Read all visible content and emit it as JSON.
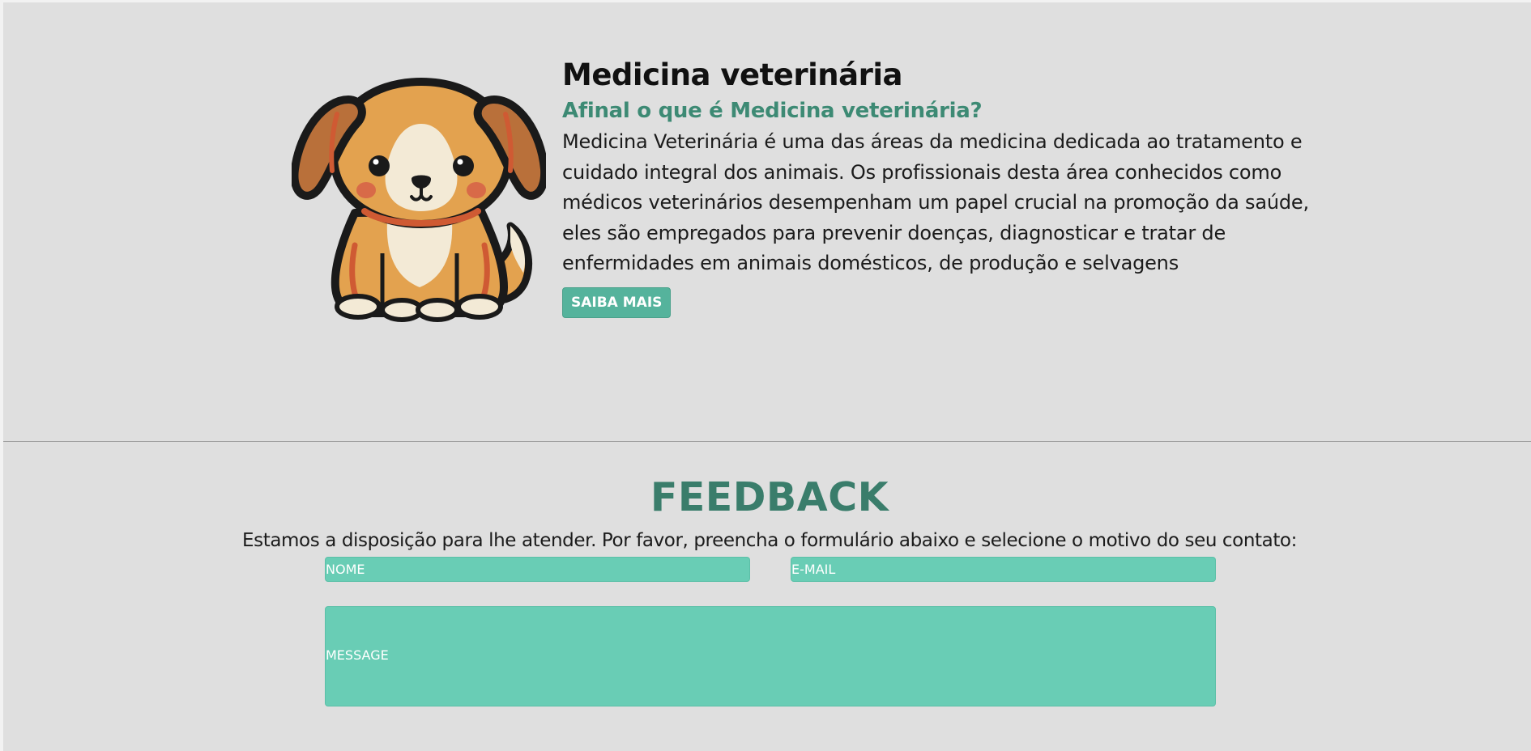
{
  "about": {
    "title": "Medicina veterinária",
    "subtitle": "Afinal o que é Medicina veterinária?",
    "body": "Medicina Veterinária é uma das áreas da medicina dedicada ao tratamento e cuidado integral dos animais. Os profissionais desta área conhecidos como médicos veterinários desempenham um papel crucial na promoção da saúde, eles são empregados para prevenir doenças, diagnosticar e tratar de enfermidades em animais domésticos, de produção e selvagens",
    "button_label": "SAIBA MAIS",
    "image_icon": "puppy-illustration"
  },
  "feedback": {
    "title": "FEEDBACK",
    "description": "Estamos a disposição para lhe atender. Por favor, preencha o formulário abaixo e selecione o motivo do seu contato:",
    "name_placeholder": "NOME",
    "email_placeholder": "E-MAIL",
    "message_placeholder": "MESSAGE"
  },
  "colors": {
    "background": "#dfdfdf",
    "accent_dark": "#3a7d6b",
    "accent_subtitle": "#3d8a74",
    "button": "#55b39c",
    "field": "#69cdb5",
    "dog_fur": "#e3a24f",
    "dog_ear": "#b9703a"
  }
}
